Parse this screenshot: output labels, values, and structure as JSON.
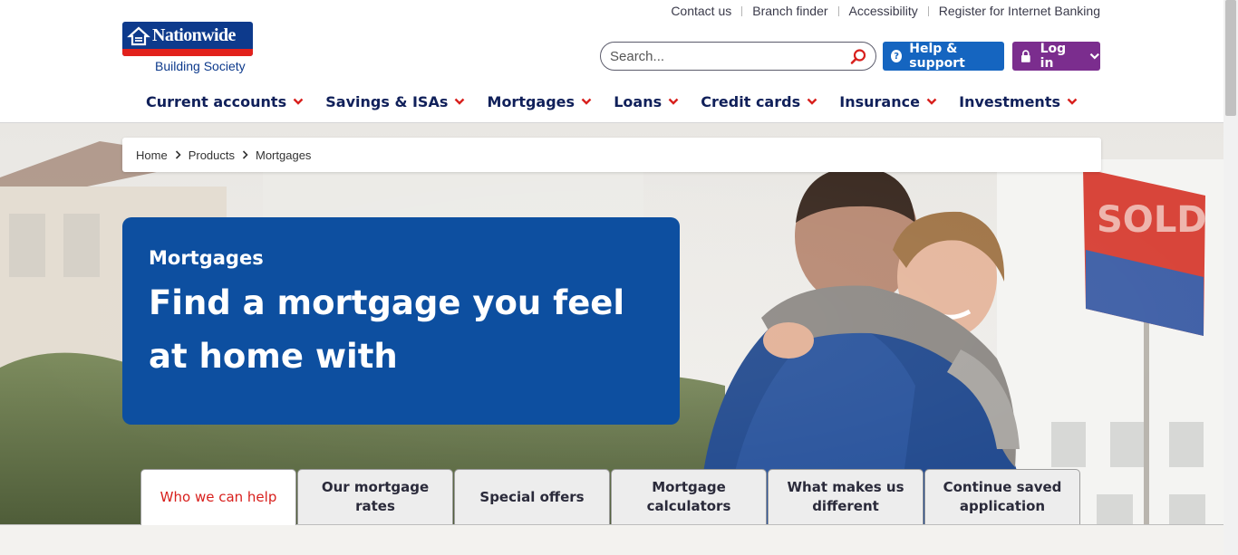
{
  "utility_links": [
    "Contact us",
    "Branch finder",
    "Accessibility",
    "Register for Internet Banking"
  ],
  "logo": {
    "name": "Nationwide",
    "sub": "Building Society",
    "icon": "house-logo-icon"
  },
  "search": {
    "placeholder": "Search...",
    "icon": "search-icon"
  },
  "help_button": {
    "label": "Help & support",
    "icon": "question-icon"
  },
  "login_button": {
    "label": "Log in",
    "icon": "lock-icon"
  },
  "nav": [
    "Current accounts",
    "Savings & ISAs",
    "Mortgages",
    "Loans",
    "Credit cards",
    "Insurance",
    "Investments"
  ],
  "breadcrumb": [
    "Home",
    "Products",
    "Mortgages"
  ],
  "hero": {
    "eyebrow": "Mortgages",
    "headline": "Find a mortgage you feel at home with",
    "sign_text": "SOLD"
  },
  "tabs": [
    {
      "label": "Who we can help",
      "active": true
    },
    {
      "label": "Our mortgage rates",
      "active": false
    },
    {
      "label": "Special offers",
      "active": false
    },
    {
      "label": "Mortgage calculators",
      "active": false
    },
    {
      "label": "What makes us different",
      "active": false
    },
    {
      "label": "Continue saved application",
      "active": false
    }
  ],
  "colors": {
    "brand_blue": "#0d3a8c",
    "brand_red": "#e2211c",
    "hero_card": "#0d4fa0",
    "help_button": "#1565c0",
    "login_button": "#7b2d8e",
    "active_tab_text": "#d8201d"
  }
}
